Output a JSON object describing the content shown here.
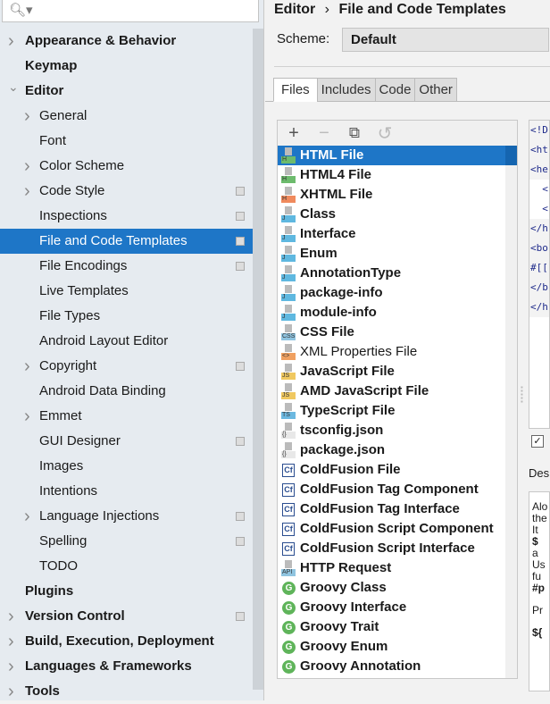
{
  "search": {
    "icon": "search-icon",
    "value": ""
  },
  "tree": [
    {
      "label": "Appearance & Behavior",
      "level": 0,
      "arrow": "right",
      "bold": true
    },
    {
      "label": "Keymap",
      "level": 0,
      "arrow": "",
      "bold": true
    },
    {
      "label": "Editor",
      "level": 0,
      "arrow": "down",
      "bold": true
    },
    {
      "label": "General",
      "level": 1,
      "arrow": "right"
    },
    {
      "label": "Font",
      "level": 1,
      "arrow": ""
    },
    {
      "label": "Color Scheme",
      "level": 1,
      "arrow": "right"
    },
    {
      "label": "Code Style",
      "level": 1,
      "arrow": "right",
      "copy": true
    },
    {
      "label": "Inspections",
      "level": 1,
      "arrow": "",
      "copy": true
    },
    {
      "label": "File and Code Templates",
      "level": 1,
      "arrow": "",
      "copy": true,
      "selected": true
    },
    {
      "label": "File Encodings",
      "level": 1,
      "arrow": "",
      "copy": true
    },
    {
      "label": "Live Templates",
      "level": 1,
      "arrow": ""
    },
    {
      "label": "File Types",
      "level": 1,
      "arrow": ""
    },
    {
      "label": "Android Layout Editor",
      "level": 1,
      "arrow": ""
    },
    {
      "label": "Copyright",
      "level": 1,
      "arrow": "right",
      "copy": true
    },
    {
      "label": "Android Data Binding",
      "level": 1,
      "arrow": ""
    },
    {
      "label": "Emmet",
      "level": 1,
      "arrow": "right"
    },
    {
      "label": "GUI Designer",
      "level": 1,
      "arrow": "",
      "copy": true
    },
    {
      "label": "Images",
      "level": 1,
      "arrow": ""
    },
    {
      "label": "Intentions",
      "level": 1,
      "arrow": ""
    },
    {
      "label": "Language Injections",
      "level": 1,
      "arrow": "right",
      "copy": true
    },
    {
      "label": "Spelling",
      "level": 1,
      "arrow": "",
      "copy": true
    },
    {
      "label": "TODO",
      "level": 1,
      "arrow": ""
    },
    {
      "label": "Plugins",
      "level": 0,
      "arrow": "",
      "bold": true
    },
    {
      "label": "Version Control",
      "level": 0,
      "arrow": "right",
      "bold": true,
      "copy": true
    },
    {
      "label": "Build, Execution, Deployment",
      "level": 0,
      "arrow": "right",
      "bold": true
    },
    {
      "label": "Languages & Frameworks",
      "level": 0,
      "arrow": "right",
      "bold": true
    },
    {
      "label": "Tools",
      "level": 0,
      "arrow": "right",
      "bold": true
    }
  ],
  "breadcrumb": {
    "parent": "Editor",
    "separator": "›",
    "current": "File and Code Templates"
  },
  "scheme": {
    "label": "Scheme:",
    "value": "Default"
  },
  "tabs": [
    {
      "label": "Files",
      "active": true
    },
    {
      "label": "Includes"
    },
    {
      "label": "Code"
    },
    {
      "label": "Other"
    }
  ],
  "toolbar": {
    "add": "+",
    "remove": "−",
    "copy": "⧉",
    "reset": "↺"
  },
  "files": [
    {
      "label": "HTML File",
      "icon": "html",
      "tag": "H",
      "color": "#6dbb6d",
      "selected": true
    },
    {
      "label": "HTML4 File",
      "icon": "html",
      "tag": "H",
      "color": "#6dbb6d"
    },
    {
      "label": "XHTML File",
      "icon": "html",
      "tag": "H",
      "color": "#f08a5d"
    },
    {
      "label": "Class",
      "icon": "java",
      "tag": "J",
      "color": "#5fb8e0"
    },
    {
      "label": "Interface",
      "icon": "java",
      "tag": "J",
      "color": "#5fb8e0"
    },
    {
      "label": "Enum",
      "icon": "java",
      "tag": "J",
      "color": "#5fb8e0"
    },
    {
      "label": "AnnotationType",
      "icon": "java",
      "tag": "J",
      "color": "#5fb8e0"
    },
    {
      "label": "package-info",
      "icon": "java",
      "tag": "J",
      "color": "#5fb8e0"
    },
    {
      "label": "module-info",
      "icon": "java",
      "tag": "J",
      "color": "#5fb8e0"
    },
    {
      "label": "CSS File",
      "icon": "css",
      "tag": "CSS",
      "color": "#8fc4e0"
    },
    {
      "label": "XML Properties File",
      "icon": "xml",
      "tag": "<>",
      "color": "#f0a060",
      "normal": true
    },
    {
      "label": "JavaScript File",
      "icon": "js",
      "tag": "JS",
      "color": "#f0c860"
    },
    {
      "label": "AMD JavaScript File",
      "icon": "js",
      "tag": "JS",
      "color": "#f0c860"
    },
    {
      "label": "TypeScript File",
      "icon": "ts",
      "tag": "TS",
      "color": "#6cb8e0"
    },
    {
      "label": "tsconfig.json",
      "icon": "json",
      "tag": "{}",
      "color": "#e8e8e8"
    },
    {
      "label": "package.json",
      "icon": "json",
      "tag": "{}",
      "color": "#e8e8e8"
    },
    {
      "label": "ColdFusion File",
      "icon": "cf",
      "tag": "Cf"
    },
    {
      "label": "ColdFusion Tag Component",
      "icon": "cf",
      "tag": "Cf"
    },
    {
      "label": "ColdFusion Tag Interface",
      "icon": "cf",
      "tag": "Cf"
    },
    {
      "label": "ColdFusion Script Component",
      "icon": "cf",
      "tag": "Cf"
    },
    {
      "label": "ColdFusion Script Interface",
      "icon": "cf",
      "tag": "Cf"
    },
    {
      "label": "HTTP Request",
      "icon": "api",
      "tag": "API",
      "color": "#8fc4e0"
    },
    {
      "label": "Groovy Class",
      "icon": "groovy",
      "tag": "G"
    },
    {
      "label": "Groovy Interface",
      "icon": "groovy",
      "tag": "G"
    },
    {
      "label": "Groovy Trait",
      "icon": "groovy",
      "tag": "G"
    },
    {
      "label": "Groovy Enum",
      "icon": "groovy",
      "tag": "G"
    },
    {
      "label": "Groovy Annotation",
      "icon": "groovy",
      "tag": "G"
    }
  ],
  "code_lines": [
    "<!D",
    "<ht",
    "<he",
    "  <",
    "  <",
    "</h",
    "<bo",
    "#[[",
    "</b",
    "</h"
  ],
  "checkbox": {
    "checked": true,
    "mark": "✓"
  },
  "description": {
    "label": "Des",
    "lines": [
      "Alo",
      "the",
      "It",
      "$",
      "a",
      "Us",
      "fu",
      "#p",
      "",
      "Pr",
      "",
      "${"
    ]
  }
}
